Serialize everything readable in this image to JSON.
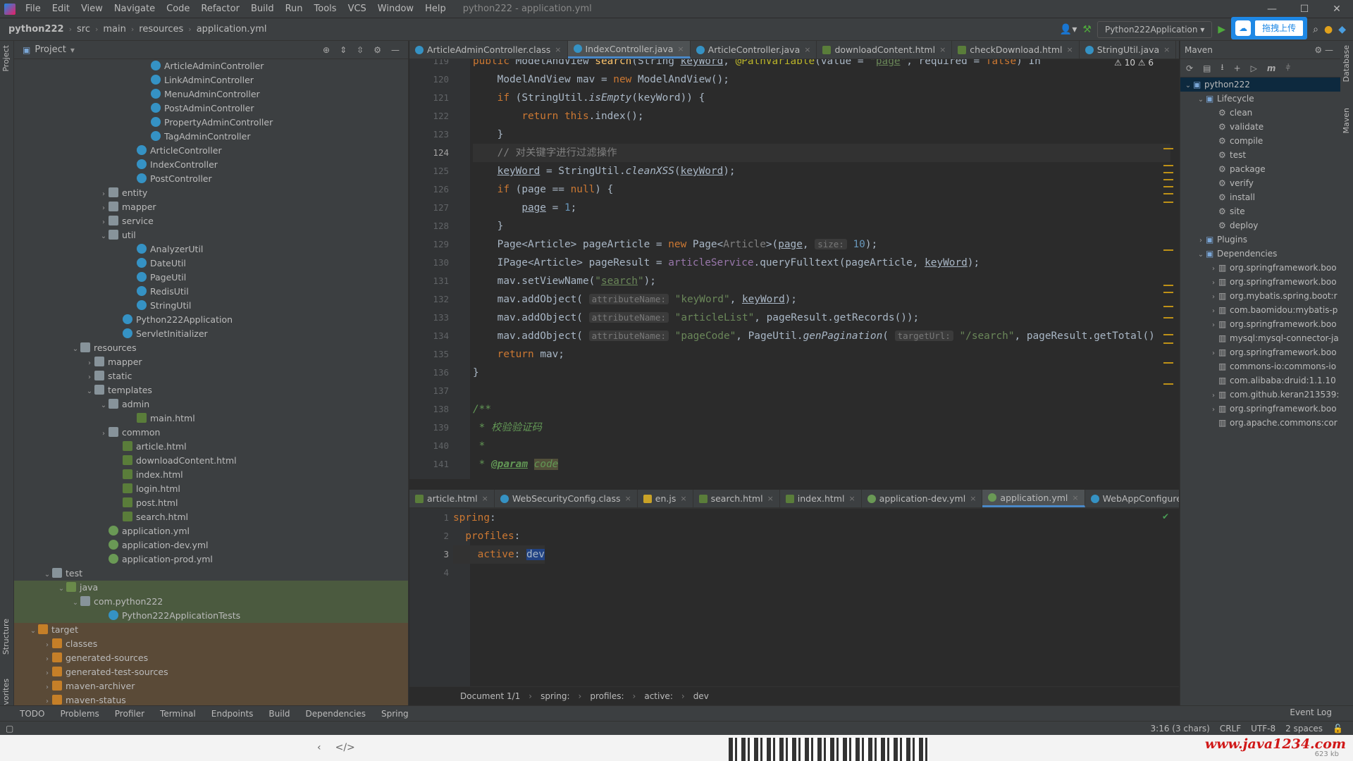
{
  "titlebar": {
    "menus": [
      "File",
      "Edit",
      "View",
      "Navigate",
      "Code",
      "Refactor",
      "Build",
      "Run",
      "Tools",
      "VCS",
      "Window",
      "Help"
    ],
    "window_title": "python222 - application.yml"
  },
  "navbar": {
    "breadcrumbs": [
      "python222",
      "src",
      "main",
      "resources",
      "application.yml"
    ],
    "run_config": "Python222Application",
    "upload_label": "拖拽上传"
  },
  "left_strip": {
    "project": "Project",
    "structure": "Structure",
    "favorites": "Favorites"
  },
  "project": {
    "title": "Project",
    "items": [
      {
        "label": "ArticleAdminController",
        "indent": 9,
        "icon": "cls",
        "arrow": ""
      },
      {
        "label": "LinkAdminController",
        "indent": 9,
        "icon": "cls",
        "arrow": ""
      },
      {
        "label": "MenuAdminController",
        "indent": 9,
        "icon": "cls",
        "arrow": ""
      },
      {
        "label": "PostAdminController",
        "indent": 9,
        "icon": "cls",
        "arrow": ""
      },
      {
        "label": "PropertyAdminController",
        "indent": 9,
        "icon": "cls",
        "arrow": ""
      },
      {
        "label": "TagAdminController",
        "indent": 9,
        "icon": "cls",
        "arrow": ""
      },
      {
        "label": "ArticleController",
        "indent": 8,
        "icon": "cls",
        "arrow": ""
      },
      {
        "label": "IndexController",
        "indent": 8,
        "icon": "cls",
        "arrow": ""
      },
      {
        "label": "PostController",
        "indent": 8,
        "icon": "cls",
        "arrow": ""
      },
      {
        "label": "entity",
        "indent": 6,
        "icon": "dir",
        "arrow": "›"
      },
      {
        "label": "mapper",
        "indent": 6,
        "icon": "dir",
        "arrow": "›"
      },
      {
        "label": "service",
        "indent": 6,
        "icon": "dir",
        "arrow": "›"
      },
      {
        "label": "util",
        "indent": 6,
        "icon": "dir",
        "arrow": "⌄"
      },
      {
        "label": "AnalyzerUtil",
        "indent": 8,
        "icon": "cls",
        "arrow": ""
      },
      {
        "label": "DateUtil",
        "indent": 8,
        "icon": "cls",
        "arrow": ""
      },
      {
        "label": "PageUtil",
        "indent": 8,
        "icon": "cls",
        "arrow": ""
      },
      {
        "label": "RedisUtil",
        "indent": 8,
        "icon": "cls",
        "arrow": ""
      },
      {
        "label": "StringUtil",
        "indent": 8,
        "icon": "cls",
        "arrow": ""
      },
      {
        "label": "Python222Application",
        "indent": 7,
        "icon": "cls",
        "arrow": ""
      },
      {
        "label": "ServletInitializer",
        "indent": 7,
        "icon": "cls",
        "arrow": ""
      },
      {
        "label": "resources",
        "indent": 4,
        "icon": "dir",
        "arrow": "⌄"
      },
      {
        "label": "mapper",
        "indent": 5,
        "icon": "dir",
        "arrow": "›"
      },
      {
        "label": "static",
        "indent": 5,
        "icon": "dir",
        "arrow": "›"
      },
      {
        "label": "templates",
        "indent": 5,
        "icon": "dir",
        "arrow": "⌄"
      },
      {
        "label": "admin",
        "indent": 6,
        "icon": "dir",
        "arrow": "⌄"
      },
      {
        "label": "main.html",
        "indent": 8,
        "icon": "html",
        "arrow": ""
      },
      {
        "label": "common",
        "indent": 6,
        "icon": "dir",
        "arrow": "›"
      },
      {
        "label": "article.html",
        "indent": 7,
        "icon": "html",
        "arrow": ""
      },
      {
        "label": "downloadContent.html",
        "indent": 7,
        "icon": "html",
        "arrow": ""
      },
      {
        "label": "index.html",
        "indent": 7,
        "icon": "html",
        "arrow": ""
      },
      {
        "label": "login.html",
        "indent": 7,
        "icon": "html",
        "arrow": ""
      },
      {
        "label": "post.html",
        "indent": 7,
        "icon": "html",
        "arrow": ""
      },
      {
        "label": "search.html",
        "indent": 7,
        "icon": "html",
        "arrow": ""
      },
      {
        "label": "application.yml",
        "indent": 6,
        "icon": "yml",
        "arrow": ""
      },
      {
        "label": "application-dev.yml",
        "indent": 6,
        "icon": "yml",
        "arrow": ""
      },
      {
        "label": "application-prod.yml",
        "indent": 6,
        "icon": "yml",
        "arrow": ""
      },
      {
        "label": "test",
        "indent": 2,
        "icon": "dir",
        "arrow": "⌄"
      },
      {
        "label": "java",
        "indent": 3,
        "icon": "dir-g",
        "arrow": "⌄",
        "hl": "green"
      },
      {
        "label": "com.python222",
        "indent": 4,
        "icon": "dir",
        "arrow": "⌄",
        "hl": "green"
      },
      {
        "label": "Python222ApplicationTests",
        "indent": 6,
        "icon": "cls",
        "arrow": "",
        "hl": "green"
      },
      {
        "label": "target",
        "indent": 1,
        "icon": "dir-o",
        "arrow": "⌄",
        "hl": "orange"
      },
      {
        "label": "classes",
        "indent": 2,
        "icon": "dir-o",
        "arrow": "›",
        "hl": "orange"
      },
      {
        "label": "generated-sources",
        "indent": 2,
        "icon": "dir-o",
        "arrow": "›",
        "hl": "orange"
      },
      {
        "label": "generated-test-sources",
        "indent": 2,
        "icon": "dir-o",
        "arrow": "›",
        "hl": "orange"
      },
      {
        "label": "maven-archiver",
        "indent": 2,
        "icon": "dir-o",
        "arrow": "›",
        "hl": "orange"
      },
      {
        "label": "maven-status",
        "indent": 2,
        "icon": "dir-o",
        "arrow": "›",
        "hl": "orange"
      }
    ]
  },
  "editor": {
    "tabs": [
      {
        "label": "ArticleAdminController.class",
        "icon": "c"
      },
      {
        "label": "IndexController.java",
        "icon": "c",
        "active": true
      },
      {
        "label": "ArticleController.java",
        "icon": "c"
      },
      {
        "label": "downloadContent.html",
        "icon": "h"
      },
      {
        "label": "checkDownload.html",
        "icon": "h"
      },
      {
        "label": "StringUtil.java",
        "icon": "c"
      }
    ],
    "error_counts": "⚠ 10  ⚠ 6",
    "line_numbers": [
      "119",
      "120",
      "121",
      "122",
      "123",
      "124",
      "125",
      "126",
      "127",
      "128",
      "129",
      "130",
      "131",
      "132",
      "133",
      "134",
      "135",
      "136",
      "137",
      "138",
      "139",
      "140",
      "141"
    ],
    "lines": [
      "<span class=\"kw\">public </span>ModelAndView <span class=\"fn\">search</span>(String <span class=\"und\">keyWord</span>, <span class=\"ann\">@PathVariable</span>(value = <span class=\"str\">\"<span class=\"und\">page</span>\"</span>, required = <span class=\"kw\">false</span>) In",
      "    ModelAndView mav = <span class=\"kw\">new </span>ModelAndView();",
      "    <span class=\"kw\">if </span>(StringUtil.<span class=\"it\">isEmpty</span>(keyWord)) {",
      "        <span class=\"kw\">return this</span>.index();",
      "    }",
      "    <span class=\"cmt\">// 对关键字进行过滤操作</span>",
      "    <span class=\"und\">keyWord</span> = StringUtil.<span class=\"it\">cleanXSS</span>(<span class=\"und\">keyWord</span>);",
      "    <span class=\"kw\">if </span>(page == <span class=\"kw\">null</span>) {",
      "        <span class=\"und\">page</span> = <span style=\"color:#6897bb\">1</span>;",
      "    }",
      "    Page&lt;Article&gt; pageArticle = <span class=\"kw\">new </span>Page&lt;<span class=\"cmt\">Article</span>&gt;(<span class=\"und\">page</span>, <span class=\"hint\">size:</span> <span style=\"color:#6897bb\">10</span>);",
      "    IPage&lt;Article&gt; pageResult = <span class=\"fld\">articleService</span>.queryFulltext(pageArticle, <span class=\"und\">keyWord</span>);",
      "    mav.setViewName(<span class=\"str\">\"<span class=\"und\">search</span>\"</span>);",
      "    mav.addObject( <span class=\"hint\">attributeName:</span> <span class=\"str\">\"keyWord\"</span>, <span class=\"und\">keyWord</span>);",
      "    mav.addObject( <span class=\"hint\">attributeName:</span> <span class=\"str\">\"articleList\"</span>, pageResult.getRecords());",
      "    mav.addObject( <span class=\"hint\">attributeName:</span> <span class=\"str\">\"pageCode\"</span>, PageUtil.<span class=\"it\">genPagination</span>( <span class=\"hint\">targetUrl:</span> <span class=\"str\">\"/search\"</span>, pageResult.getTotal()",
      "    <span class=\"kw\">return </span>mav;",
      "}",
      "",
      "<span class=\"jd\">/**</span>",
      "<span class=\"jd\"> * 校验验证码</span>",
      "<span class=\"jd\"> *</span>",
      "<span class=\"jd\"> * <span class=\"und\" style=\"font-weight:bold\">@param</span> <span style=\"background:#52503a\">code</span></span>"
    ]
  },
  "yaml_editor": {
    "tabs": [
      {
        "label": "article.html",
        "icon": "h"
      },
      {
        "label": "WebSecurityConfig.class",
        "icon": "c"
      },
      {
        "label": "en.js",
        "icon": "j"
      },
      {
        "label": "search.html",
        "icon": "h"
      },
      {
        "label": "index.html",
        "icon": "h"
      },
      {
        "label": "application-dev.yml",
        "icon": "y"
      },
      {
        "label": "application.yml",
        "icon": "y",
        "active": true
      },
      {
        "label": "WebAppConfigurer.ja",
        "icon": "c"
      }
    ],
    "line_numbers": [
      "1",
      "2",
      "3",
      "4"
    ],
    "lines": [
      "<span class=\"kw\">spring</span>:",
      "  <span class=\"kw\">profiles</span>:",
      "    <span class=\"kw\">active</span>: <span class=\"sel\">dev</span>",
      ""
    ],
    "breadcrumb": [
      "Document 1/1",
      "spring:",
      "profiles:",
      "active:",
      "dev"
    ]
  },
  "maven": {
    "title": "Maven",
    "items": [
      {
        "label": "python222",
        "indent": 0,
        "arrow": "⌄",
        "glyph": "▣",
        "selected": true
      },
      {
        "label": "Lifecycle",
        "indent": 1,
        "arrow": "⌄",
        "glyph": "▣"
      },
      {
        "label": "clean",
        "indent": 2,
        "arrow": "",
        "glyph": "⚙"
      },
      {
        "label": "validate",
        "indent": 2,
        "arrow": "",
        "glyph": "⚙"
      },
      {
        "label": "compile",
        "indent": 2,
        "arrow": "",
        "glyph": "⚙"
      },
      {
        "label": "test",
        "indent": 2,
        "arrow": "",
        "glyph": "⚙"
      },
      {
        "label": "package",
        "indent": 2,
        "arrow": "",
        "glyph": "⚙"
      },
      {
        "label": "verify",
        "indent": 2,
        "arrow": "",
        "glyph": "⚙"
      },
      {
        "label": "install",
        "indent": 2,
        "arrow": "",
        "glyph": "⚙"
      },
      {
        "label": "site",
        "indent": 2,
        "arrow": "",
        "glyph": "⚙"
      },
      {
        "label": "deploy",
        "indent": 2,
        "arrow": "",
        "glyph": "⚙"
      },
      {
        "label": "Plugins",
        "indent": 1,
        "arrow": "›",
        "glyph": "▣"
      },
      {
        "label": "Dependencies",
        "indent": 1,
        "arrow": "⌄",
        "glyph": "▣"
      },
      {
        "label": "org.springframework.boo",
        "indent": 2,
        "arrow": "›",
        "glyph": "|||"
      },
      {
        "label": "org.springframework.boo",
        "indent": 2,
        "arrow": "›",
        "glyph": "|||"
      },
      {
        "label": "org.mybatis.spring.boot:r",
        "indent": 2,
        "arrow": "›",
        "glyph": "|||"
      },
      {
        "label": "com.baomidou:mybatis-p",
        "indent": 2,
        "arrow": "›",
        "glyph": "|||"
      },
      {
        "label": "org.springframework.boo",
        "indent": 2,
        "arrow": "›",
        "glyph": "|||"
      },
      {
        "label": "mysql:mysql-connector-ja",
        "indent": 2,
        "arrow": "",
        "glyph": "|||"
      },
      {
        "label": "org.springframework.boo",
        "indent": 2,
        "arrow": "›",
        "glyph": "|||"
      },
      {
        "label": "commons-io:commons-io",
        "indent": 2,
        "arrow": "",
        "glyph": "|||"
      },
      {
        "label": "com.alibaba:druid:1.1.10",
        "indent": 2,
        "arrow": "",
        "glyph": "|||"
      },
      {
        "label": "com.github.keran213539:",
        "indent": 2,
        "arrow": "›",
        "glyph": "|||"
      },
      {
        "label": "org.springframework.boo",
        "indent": 2,
        "arrow": "›",
        "glyph": "|||"
      },
      {
        "label": "org.apache.commons:cor",
        "indent": 2,
        "arrow": "",
        "glyph": "|||"
      }
    ]
  },
  "right_strip": {
    "database": "Database",
    "maven": "Maven"
  },
  "toolwindows": [
    "TODO",
    "Problems",
    "Profiler",
    "Terminal",
    "Endpoints",
    "Build",
    "Dependencies",
    "Spring"
  ],
  "statusbar": {
    "event_log": "Event Log",
    "position": "3:16 (3 chars)",
    "line_sep": "CRLF",
    "encoding": "UTF-8",
    "indent": "2 spaces"
  },
  "watermark": {
    "site": "www.java1234.com",
    "sub": "623 kb"
  }
}
